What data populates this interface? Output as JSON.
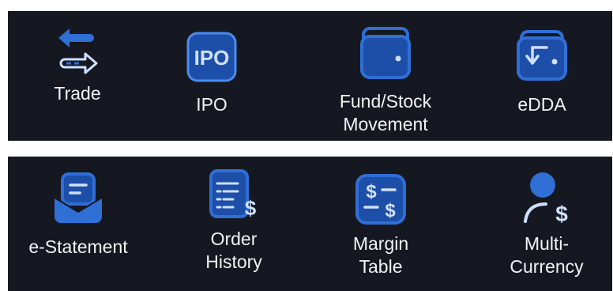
{
  "colors": {
    "panel_bg": "#151820",
    "icon_blue": "#2f6fd6",
    "icon_blue_fill": "#1d4ea8",
    "icon_light": "#cfe0ff",
    "label_text": "#f2f3f5"
  },
  "top_row": [
    {
      "icon": "arrows-swap-icon",
      "label": "Trade"
    },
    {
      "icon": "ipo-badge-icon",
      "label": "IPO",
      "badge_text": "IPO"
    },
    {
      "icon": "wallet-icon",
      "label_line1": "Fund/Stock",
      "label_line2": "Movement"
    },
    {
      "icon": "wallet-return-icon",
      "label": "eDDA"
    }
  ],
  "bottom_row": [
    {
      "icon": "envelope-message-icon",
      "label": "e-Statement"
    },
    {
      "icon": "document-dollar-icon",
      "label_line1": "Order",
      "label_line2": "History"
    },
    {
      "icon": "dollar-table-icon",
      "label_line1": "Margin",
      "label_line2": "Table"
    },
    {
      "icon": "person-dollar-icon",
      "label_line1": "Multi-",
      "label_line2": "Currency"
    }
  ]
}
